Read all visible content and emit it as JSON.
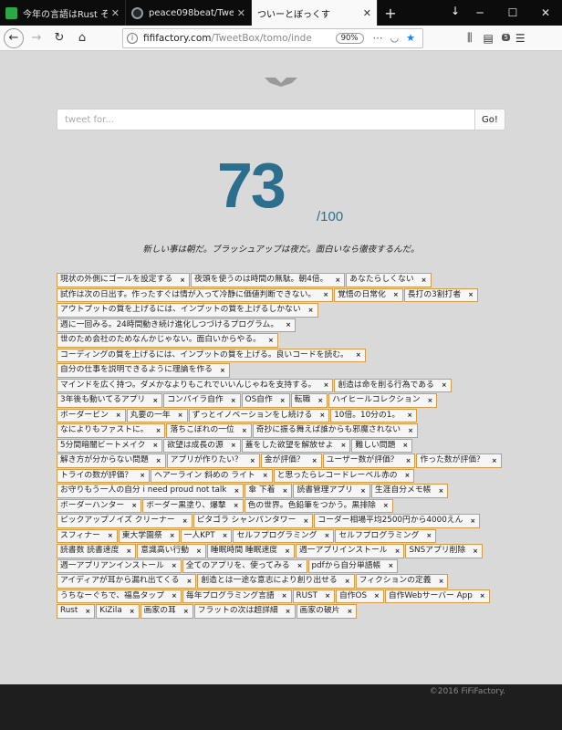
{
  "browser": {
    "tabs": [
      {
        "title": "今年の言語はRust その3",
        "icon": "green-chat-icon",
        "active": false
      },
      {
        "title": "peace098beat/TweetBox",
        "icon": "github-icon",
        "active": false
      },
      {
        "title": "ついーとぼっくす",
        "icon": "",
        "active": true
      }
    ],
    "url_domain": "fififactory.com",
    "url_path": "/TweetBox/tomo/inde",
    "zoom": "90%",
    "extension_badge": "5"
  },
  "page": {
    "search": {
      "placeholder": "tweet for...",
      "value": "",
      "button_label": "Go!"
    },
    "score": {
      "value": "73",
      "max": "/100"
    },
    "motto": "新しい事は朝だ。ブラッシュアップは夜だ。面白いなら徹夜するんだ。",
    "tags": [
      "現状の外側にゴールを設定する",
      "夜頭を使うのは時間の無駄。朝4倍。",
      "あなたらしくない",
      "試作は次の日出す。作ったすぐは情が入って冷静に価値判断できない。",
      "覚悟の日常化",
      "長打の3割打者",
      "アウトプットの質を上げるには、インプットの質を上げるしかない",
      "週に一回みる。24時間動き続け進化しつづけるプログラム。",
      "世のため会社のためなんかじゃない。面白いからやる。",
      "コーディングの質を上げるには、インプットの質を上げる。良いコードを読む。",
      "自分の仕事を説明できるように理論を作る",
      "マインドを広く持つ。ダメかなよりもこれでいいんじゃねを支持する。",
      "創造は命を削る行為である",
      "3年後も動いてるアプリ",
      "コンパイラ自作",
      "OS自作",
      "転職",
      "ハイヒールコレクション",
      "ボーダービン",
      "丸要の一年",
      "ずっとイノベーションをし続ける",
      "10倍。10分の1。",
      "なによりもファストに。",
      "落ちこぼれの一位",
      "奇抄に振る舞えば誰からも邪魔されない",
      "5分間暗闇ビートメイク",
      "欲望は成長の源",
      "蓋をした欲望を解放せよ",
      "難しい問題",
      "解き方が分からない問題",
      "アプリが作りたい？",
      "金が評価？",
      "ユーザー数が評価？",
      "作った数が評価？",
      "トライの数が評価？",
      "ヘアーライン 斜めの ライト",
      "と思ったらレコードレーベル赤の",
      "お守りもう一人の自分 i need proud not talk",
      "傘 下着",
      "読書管理アプリ",
      "生涯自分メモ帳",
      "ボーダーハンター",
      "ボーダー黒塗り、爆撃",
      "色の世界。色鉛筆をつかう。黒排除",
      "ピックアップノイズ クリーナー",
      "ピタゴラ シャンパンタワー",
      "コーダー相場平均2500円から4000えん",
      "スフィナー",
      "東大学園祭",
      "一人KPT",
      "セルフプログラミング",
      "セルフプログラミング",
      "読書数 読書速度",
      "意識高い行動",
      "睡眠時間 睡眠速度",
      "週一アプリインストール",
      "SNSアプリ削除",
      "週一アプリアンインストール",
      "全てのアプリを、使ってみる",
      "pdfから自分単語帳",
      "アイディアが耳から漏れ出てくる",
      "創造とは一途な意志により創り出せる",
      "フィクションの定義",
      "うちなーぐちで、福島タップ",
      "毎年プログラミング言語",
      "RUST",
      "自作OS",
      "自作Webサーバー App",
      "Rust",
      "KiZila",
      "画家の耳",
      "フラットの次は超詳細",
      "画家の破片"
    ],
    "tag_remove_symbol": "×",
    "footer_text": "©2016 FiFiFactory."
  },
  "colors": {
    "score": "#2b6e8e",
    "tag_border": "#d39a4a",
    "page_bg": "#d9d9d9",
    "footer_bg": "#1e1e1e"
  }
}
